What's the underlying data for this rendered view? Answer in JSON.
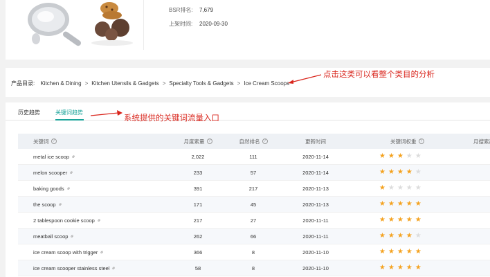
{
  "product": {
    "bsr_label": "BSR排名:",
    "bsr_value": "7,679",
    "listed_label": "上架时间:",
    "listed_value": "2020-09-30"
  },
  "category": {
    "label": "产品目录:",
    "path": [
      "Kitchen & Dining",
      "Kitchen Utensils & Gadgets",
      "Specialty Tools & Gadgets",
      "Ice Cream Scoops"
    ],
    "separator": ">",
    "annotation": "点击这类可以看整个类目的分析"
  },
  "tabs": {
    "history": "历史趋势",
    "keywords": "关键词趋势",
    "annotation": "系统提供的关键词流量入口"
  },
  "table": {
    "headers": {
      "keyword": "关键词",
      "volume": "月度索量",
      "rank": "自然排名",
      "updated": "更新时间",
      "weight": "关键词权重",
      "trend": "月搜索趋"
    },
    "rows": [
      {
        "keyword": "metal ice scoop",
        "volume": "2,022",
        "rank": "111",
        "updated": "2020-11-14",
        "stars": 3
      },
      {
        "keyword": "melon scooper",
        "volume": "233",
        "rank": "57",
        "updated": "2020-11-14",
        "stars": 4
      },
      {
        "keyword": "baking goods",
        "volume": "391",
        "rank": "217",
        "updated": "2020-11-13",
        "stars": 1
      },
      {
        "keyword": "the scoop",
        "volume": "171",
        "rank": "45",
        "updated": "2020-11-13",
        "stars": 5
      },
      {
        "keyword": "2 tablespoon cookie scoop",
        "volume": "217",
        "rank": "27",
        "updated": "2020-11-11",
        "stars": 5
      },
      {
        "keyword": "meatball scoop",
        "volume": "262",
        "rank": "66",
        "updated": "2020-11-11",
        "stars": 4
      },
      {
        "keyword": "ice cream scoop with trigger",
        "volume": "366",
        "rank": "8",
        "updated": "2020-11-10",
        "stars": 5
      },
      {
        "keyword": "ice cream scooper stainless steel",
        "volume": "58",
        "rank": "8",
        "updated": "2020-11-10",
        "stars": 5
      }
    ]
  },
  "colors": {
    "accent": "#1aa39a",
    "annotation": "#d9251c",
    "star_on": "#f4a21f",
    "star_off": "#dcdcdc"
  }
}
